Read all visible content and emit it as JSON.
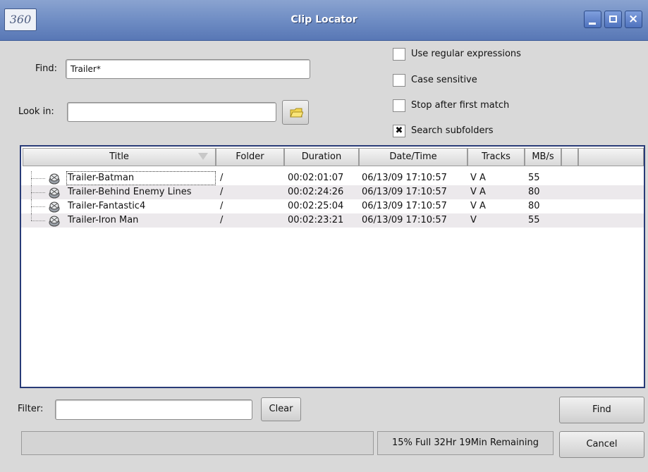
{
  "window": {
    "title": "Clip Locator",
    "logo_text": "360",
    "controls": {
      "minimize": "_",
      "maximize": "□",
      "close": "×"
    }
  },
  "search": {
    "find_label": "Find:",
    "find_value": "Trailer*",
    "look_in_label": "Look in:",
    "look_in_value": ""
  },
  "options": [
    {
      "label": "Use regular expressions",
      "checked": false
    },
    {
      "label": "Case sensitive",
      "checked": false
    },
    {
      "label": "Stop after first match",
      "checked": false
    },
    {
      "label": "Search subfolders",
      "checked": true
    }
  ],
  "table": {
    "columns": [
      "Title",
      "Folder",
      "Duration",
      "Date/Time",
      "Tracks",
      "MB/s",
      ""
    ],
    "rows": [
      {
        "title": "Trailer-Batman",
        "folder": "/",
        "duration": "00:02:01:07",
        "datetime": "06/13/09 17:10:57",
        "tracks": "V A",
        "mbs": "55"
      },
      {
        "title": "Trailer-Behind Enemy Lines",
        "folder": "/",
        "duration": "00:02:24:26",
        "datetime": "06/13/09 17:10:57",
        "tracks": "V A",
        "mbs": "80"
      },
      {
        "title": "Trailer-Fantastic4",
        "folder": "/",
        "duration": "00:02:25:04",
        "datetime": "06/13/09 17:10:57",
        "tracks": "V A",
        "mbs": "80"
      },
      {
        "title": "Trailer-Iron Man",
        "folder": "/",
        "duration": "00:02:23:21",
        "datetime": "06/13/09 17:10:57",
        "tracks": "V",
        "mbs": "55"
      }
    ]
  },
  "filter": {
    "label": "Filter:",
    "value": "",
    "clear_label": "Clear"
  },
  "actions": {
    "find_label": "Find",
    "cancel_label": "Cancel"
  },
  "status": {
    "storage": "15% Full  32Hr 19Min Remaining"
  },
  "colors": {
    "titlebar": "#6f8dc4",
    "table_border": "#283b77",
    "row_alt": "#ece9ec"
  }
}
